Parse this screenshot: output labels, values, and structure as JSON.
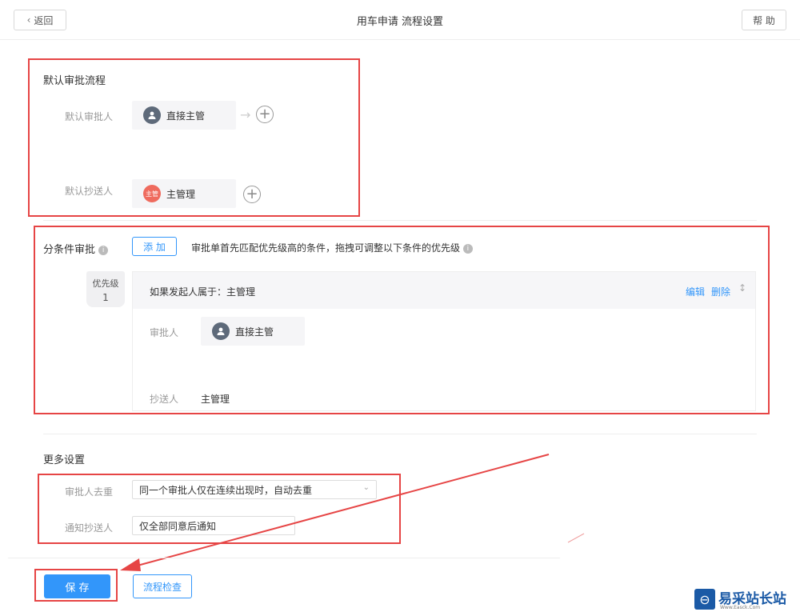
{
  "header": {
    "back_label": "返回",
    "title": "用车申请 流程设置",
    "help_label": "帮 助"
  },
  "default_flow": {
    "title": "默认审批流程",
    "approver_label": "默认审批人",
    "approver_name": "直接主管",
    "cc_label": "默认抄送人",
    "cc_name": "主管理",
    "cc_avatar_text": "主管"
  },
  "conditional": {
    "title": "分条件审批",
    "add_label": "添 加",
    "hint": "审批单首先匹配优先级高的条件，拖拽可调整以下条件的优先级",
    "priority_label": "优先级",
    "priority_value": "1",
    "condition_text": "如果发起人属于：主管理",
    "edit_label": "编辑",
    "delete_label": "删除",
    "approver_label": "审批人",
    "approver_name": "直接主管",
    "cc_label": "抄送人",
    "cc_name": "主管理"
  },
  "more": {
    "title": "更多设置",
    "dedupe_label": "审批人去重",
    "dedupe_value": "同一个审批人仅在连续出现时，自动去重",
    "notify_label": "通知抄送人",
    "notify_value": "仅全部同意后通知"
  },
  "footer": {
    "save_label": "保 存",
    "check_label": "流程检查"
  },
  "watermark": {
    "brand": "易采站长站",
    "url": "Www.Easck.Com"
  },
  "colors": {
    "accent": "#3296fa",
    "annotation": "#e64545"
  }
}
